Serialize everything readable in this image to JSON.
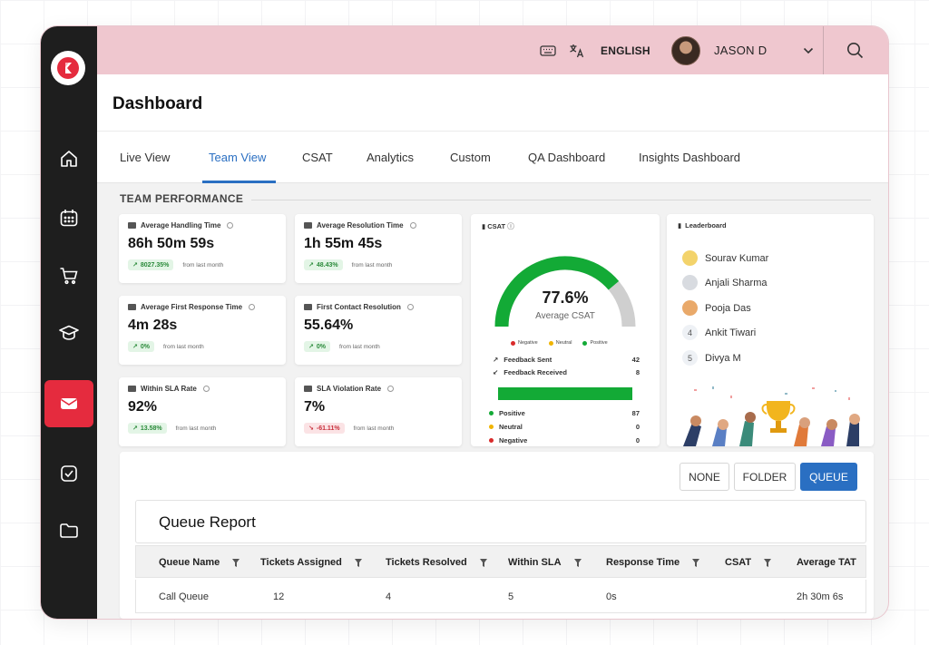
{
  "topbar": {
    "language": "ENGLISH",
    "user_name": "JASON D"
  },
  "header": {
    "title": "Dashboard"
  },
  "tabs": [
    {
      "label": "Live View"
    },
    {
      "label": "Team View"
    },
    {
      "label": "CSAT"
    },
    {
      "label": "Analytics"
    },
    {
      "label": "Custom"
    },
    {
      "label": "QA Dashboard"
    },
    {
      "label": "Insights Dashboard"
    }
  ],
  "active_tab": "Team View",
  "section": {
    "title": "TEAM PERFORMANCE"
  },
  "metrics": [
    {
      "title": "Average Handling Time",
      "value": "86h 50m 59s",
      "change": "8027.35%",
      "trend": "up",
      "foot": "from last month"
    },
    {
      "title": "Average Resolution Time",
      "value": "1h 55m 45s",
      "change": "48.43%",
      "trend": "up",
      "foot": "from last month"
    },
    {
      "title": "Average First Response Time",
      "value": "4m 28s",
      "change": "0%",
      "trend": "up",
      "foot": "from last month"
    },
    {
      "title": "First Contact Resolution",
      "value": "55.64%",
      "change": "0%",
      "trend": "up",
      "foot": "from last month"
    },
    {
      "title": "Within SLA Rate",
      "value": "92%",
      "change": "13.58%",
      "trend": "up",
      "foot": "from last month"
    },
    {
      "title": "SLA Violation Rate",
      "value": "7%",
      "change": "-61.11%",
      "trend": "down",
      "foot": "from last month"
    }
  ],
  "csat": {
    "title": "CSAT",
    "value": "77.6%",
    "value_fraction": 0.776,
    "subtitle": "Average CSAT",
    "legend": [
      "Negative",
      "Neutral",
      "Positive"
    ],
    "feedback_sent_label": "Feedback Sent",
    "feedback_sent": "42",
    "feedback_received_label": "Feedback Received",
    "feedback_received": "8",
    "positive_label": "Positive",
    "positive": "87",
    "neutral_label": "Neutral",
    "neutral": "0",
    "negative_label": "Negative",
    "negative": "0",
    "colors": {
      "positive": "#13aa36",
      "neutral": "#f0b400",
      "negative": "#d92b2b",
      "track": "#cfcfcf"
    }
  },
  "leaderboard": {
    "title": "Leaderboard",
    "entries": [
      {
        "rank": "1",
        "name": "Sourav Kumar"
      },
      {
        "rank": "2",
        "name": "Anjali Sharma"
      },
      {
        "rank": "3",
        "name": "Pooja Das"
      },
      {
        "rank": "4",
        "name": "Ankit Tiwari"
      },
      {
        "rank": "5",
        "name": "Divya M"
      }
    ]
  },
  "queue": {
    "buttons": [
      "NONE",
      "FOLDER",
      "QUEUE"
    ],
    "active_button": "QUEUE",
    "report_title": "Queue Report",
    "columns": [
      "Queue Name",
      "Tickets Assigned",
      "Tickets Resolved",
      "Within SLA",
      "Response Time",
      "CSAT",
      "Average TAT"
    ],
    "rows": [
      [
        "Call Queue",
        "12",
        "4",
        "5",
        "0s",
        "",
        "2h 30m 6s"
      ]
    ]
  },
  "colors": {
    "accent": "#2a6fc2",
    "brand": "#e52b3e",
    "topbar": "#efc7cf",
    "sidebar": "#1e1e1e"
  }
}
